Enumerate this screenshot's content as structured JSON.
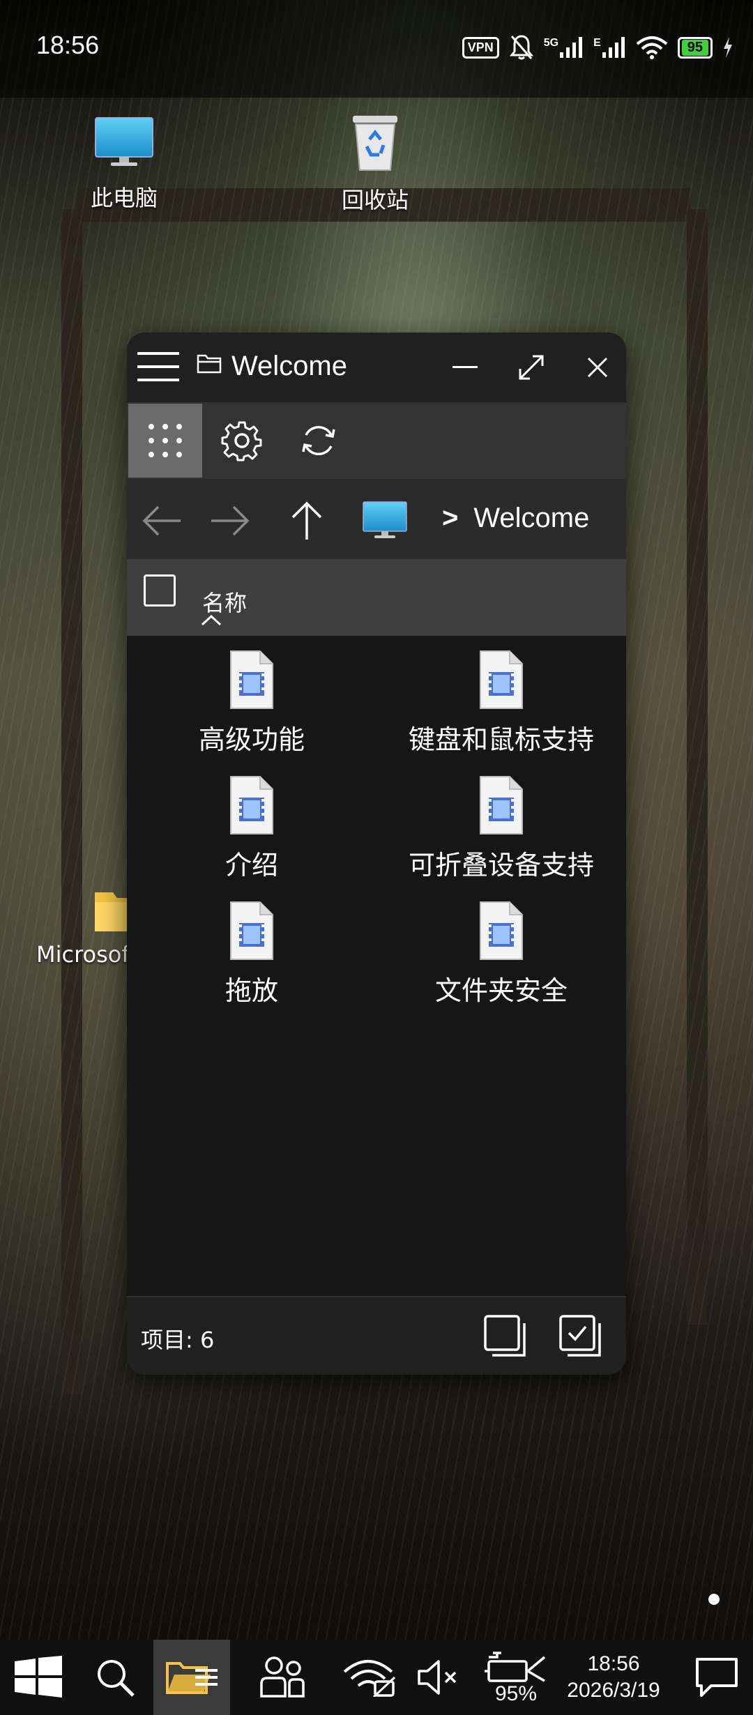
{
  "status_bar": {
    "time": "18:56",
    "vpn": "VPN",
    "signal_tag_5g": "5G",
    "signal_tag_e": "E",
    "battery": "95"
  },
  "desktop": {
    "icons": [
      {
        "label": "此电脑",
        "icon": "monitor-icon"
      },
      {
        "label": "回收站",
        "icon": "recycle-bin-icon"
      },
      {
        "label": "Microsof",
        "icon": "folder-icon"
      }
    ]
  },
  "window": {
    "title": "Welcome",
    "breadcrumb_separator": ">",
    "breadcrumb_current": "Welcome",
    "column_name": "名称",
    "files": [
      {
        "label": "高级功能",
        "icon": "video-file-icon"
      },
      {
        "label": "键盘和鼠标支持",
        "icon": "video-file-icon"
      },
      {
        "label": "介绍",
        "icon": "video-file-icon"
      },
      {
        "label": "可折叠设备支持",
        "icon": "video-file-icon"
      },
      {
        "label": "拖放",
        "icon": "video-file-icon"
      },
      {
        "label": "文件夹安全",
        "icon": "video-file-icon"
      }
    ],
    "item_count": "项目: 6"
  },
  "taskbar": {
    "battery_percent": "95%",
    "time": "18:56",
    "date": "2026/3/19"
  },
  "colors": {
    "window_bg": "#161616",
    "titlebar_bg": "#202020",
    "toolbar_bg": "#333333",
    "accent_battery": "#3ecf3a",
    "folder_yellow": "#f5c242"
  }
}
